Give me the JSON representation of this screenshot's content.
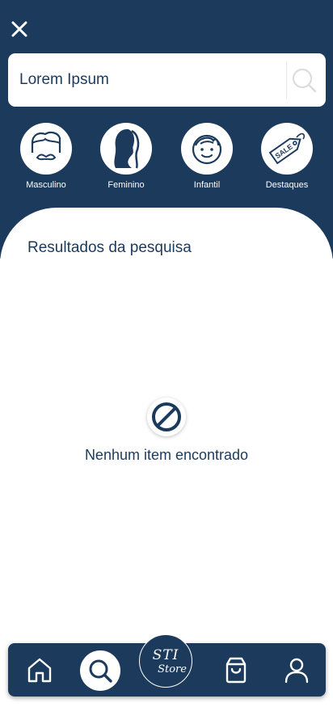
{
  "search": {
    "value": "Lorem Ipsum",
    "placeholder": ""
  },
  "categories": [
    {
      "label": "Masculino",
      "icon": "man-face-icon"
    },
    {
      "label": "Feminino",
      "icon": "woman-silhouette-icon"
    },
    {
      "label": "Infantil",
      "icon": "child-face-icon"
    },
    {
      "label": "Destaques",
      "icon": "sale-tag-icon",
      "tag_text": "SALE"
    }
  ],
  "results": {
    "title": "Resultados da pesquisa",
    "empty_message": "Nenhum item encontrado"
  },
  "nav": {
    "logo_line1": "STI",
    "logo_line2": "Store",
    "items": [
      "home-icon",
      "search-icon",
      "bag-icon",
      "user-icon"
    ]
  },
  "colors": {
    "primary": "#1b3a5c",
    "surface": "#ffffff"
  }
}
